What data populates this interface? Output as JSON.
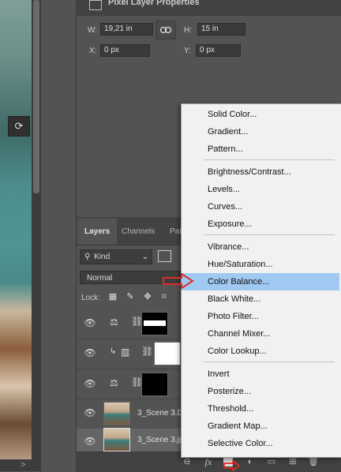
{
  "canvas": {
    "tool_icon": "warp-transform-icon",
    "bottom_glyph": ">"
  },
  "properties": {
    "title": "Pixel Layer Properties",
    "w_label": "W:",
    "w_value": "19,21 in",
    "h_label": "H:",
    "h_value": "15 in",
    "x_label": "X:",
    "x_value": "0 px",
    "y_label": "Y:",
    "y_value": "0 px",
    "link_icon": "link-icon"
  },
  "layers": {
    "tabs": [
      "Layers",
      "Channels",
      "Pat"
    ],
    "kind_label": "Kind",
    "blend_mode": "Normal",
    "lock_label": "Lock:",
    "rows": [
      {
        "name": "",
        "kind": "adjustment",
        "adj_icon": "balance-icon",
        "mask": "white-band"
      },
      {
        "name": "",
        "kind": "adjustment-clipped",
        "adj_icon": "channel-mixer-icon",
        "mask": "white"
      },
      {
        "name": "",
        "kind": "adjustment",
        "adj_icon": "balance-icon",
        "mask": "black"
      },
      {
        "name": "3_Scene 3.D",
        "kind": "pixel"
      },
      {
        "name": "3_Scene 3.jp",
        "kind": "pixel"
      }
    ],
    "footer_fx": "fx"
  },
  "menu": {
    "groups": [
      [
        "Solid Color...",
        "Gradient...",
        "Pattern..."
      ],
      [
        "Brightness/Contrast...",
        "Levels...",
        "Curves...",
        "Exposure..."
      ],
      [
        "Vibrance...",
        "Hue/Saturation...",
        "Color Balance...",
        "Black  White...",
        "Photo Filter...",
        "Channel Mixer...",
        "Color Lookup..."
      ],
      [
        "Invert",
        "Posterize...",
        "Threshold...",
        "Gradient Map...",
        "Selective Color..."
      ]
    ],
    "highlighted": "Color Balance...",
    "highlight_color": "#9fc9f1"
  },
  "annotation": {
    "arrow_color": "#e02b22"
  }
}
